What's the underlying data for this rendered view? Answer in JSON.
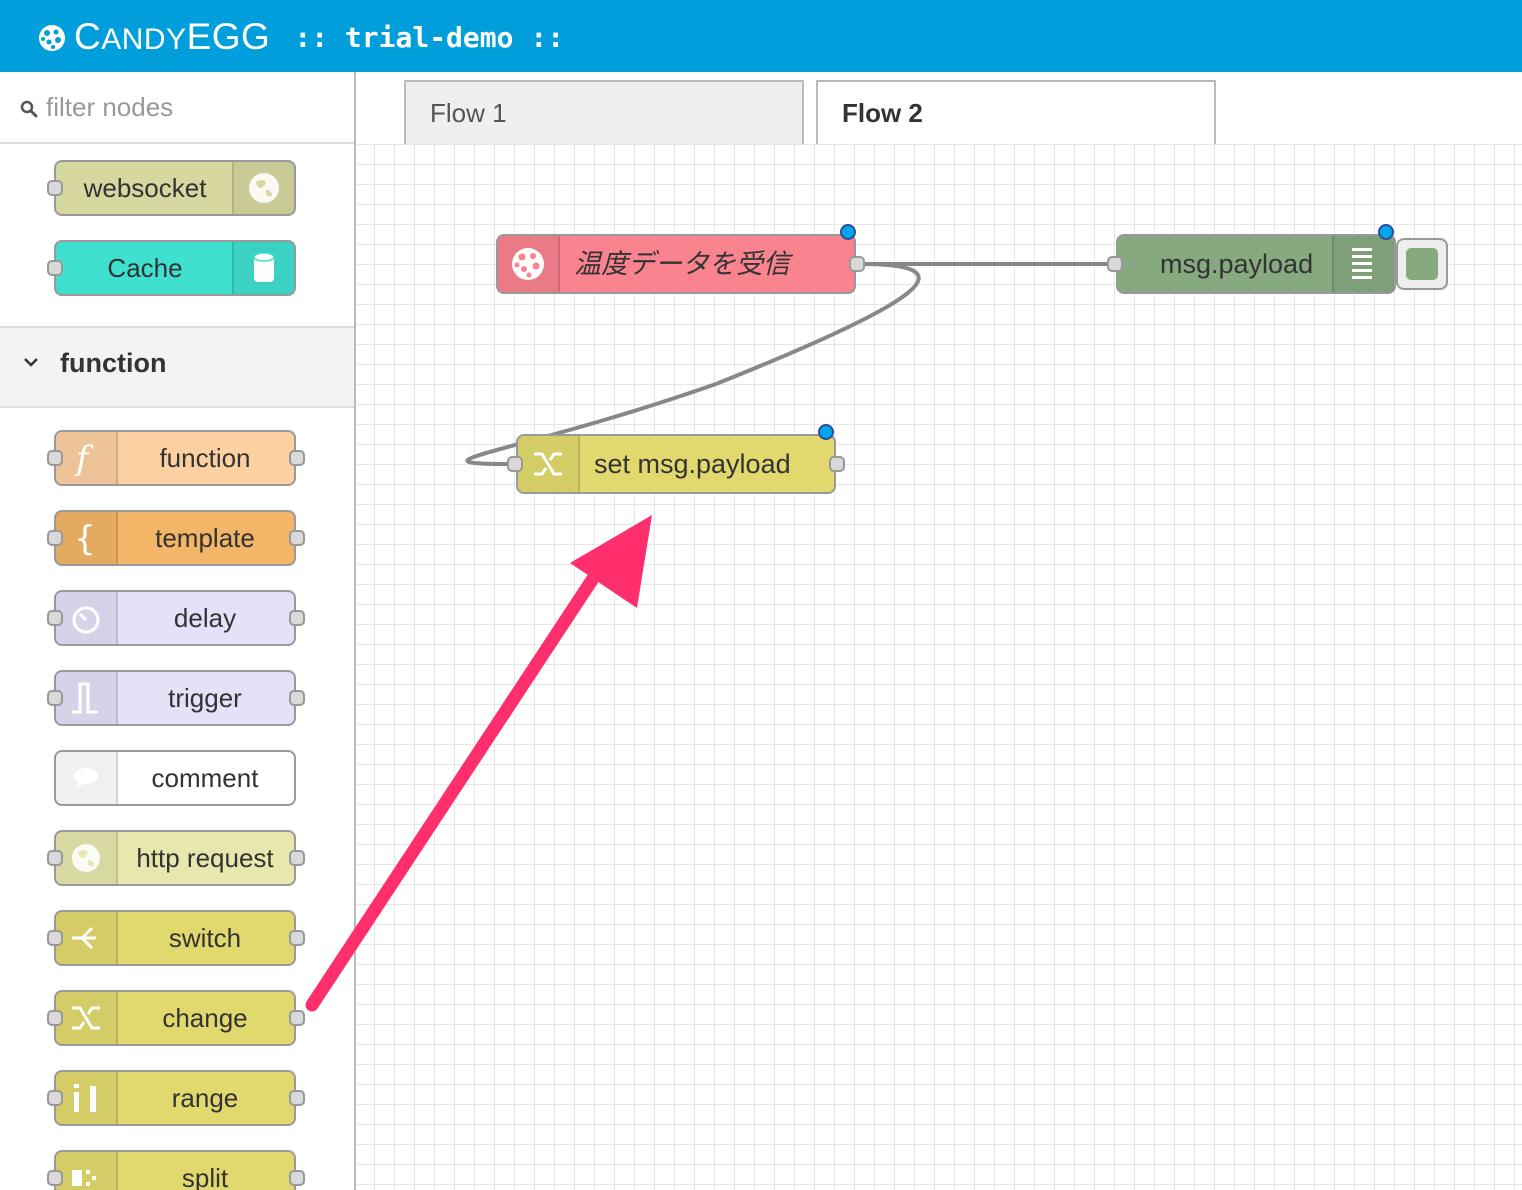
{
  "header": {
    "brand_big": "C",
    "brand_rest": "ANDY",
    "brand_egg": "EGG",
    "project": ":: trial-demo ::"
  },
  "palette": {
    "filter_placeholder": "filter nodes",
    "top_nodes": [
      {
        "label": "websocket",
        "color": "#d7d7a0"
      },
      {
        "label": "Cache",
        "color": "#3fe0d0"
      }
    ],
    "category": "function",
    "nodes": [
      {
        "label": "function",
        "color": "#fdd0a2",
        "icon": "function-icon"
      },
      {
        "label": "template",
        "color": "#f3b567",
        "icon": "braces-icon"
      },
      {
        "label": "delay",
        "color": "#e6e0f8",
        "icon": "timer-icon"
      },
      {
        "label": "trigger",
        "color": "#e6e0f8",
        "icon": "trigger-icon"
      },
      {
        "label": "comment",
        "color": "#ffffff",
        "icon": "comment-icon"
      },
      {
        "label": "http request",
        "color": "#e7e7ae",
        "icon": "globe-icon"
      },
      {
        "label": "switch",
        "color": "#e2d96e",
        "icon": "switch-icon"
      },
      {
        "label": "change",
        "color": "#e2d96e",
        "icon": "shuffle-icon"
      },
      {
        "label": "range",
        "color": "#e2d96e",
        "icon": "range-icon"
      },
      {
        "label": "split",
        "color": "#e2d96e",
        "icon": "split-icon"
      }
    ]
  },
  "tabs": [
    {
      "label": "Flow 1"
    },
    {
      "label": "Flow 2"
    }
  ],
  "flow": {
    "nodes": [
      {
        "label": "温度データを受信",
        "color": "#f9838f",
        "icon": "candyegg-icon"
      },
      {
        "label": "msg.payload",
        "color": "#87a980",
        "icon": "list-icon"
      },
      {
        "label": "set msg.payload",
        "color": "#e2d96e",
        "icon": "shuffle-icon"
      }
    ],
    "annotation_color": "#ff2e6c"
  }
}
